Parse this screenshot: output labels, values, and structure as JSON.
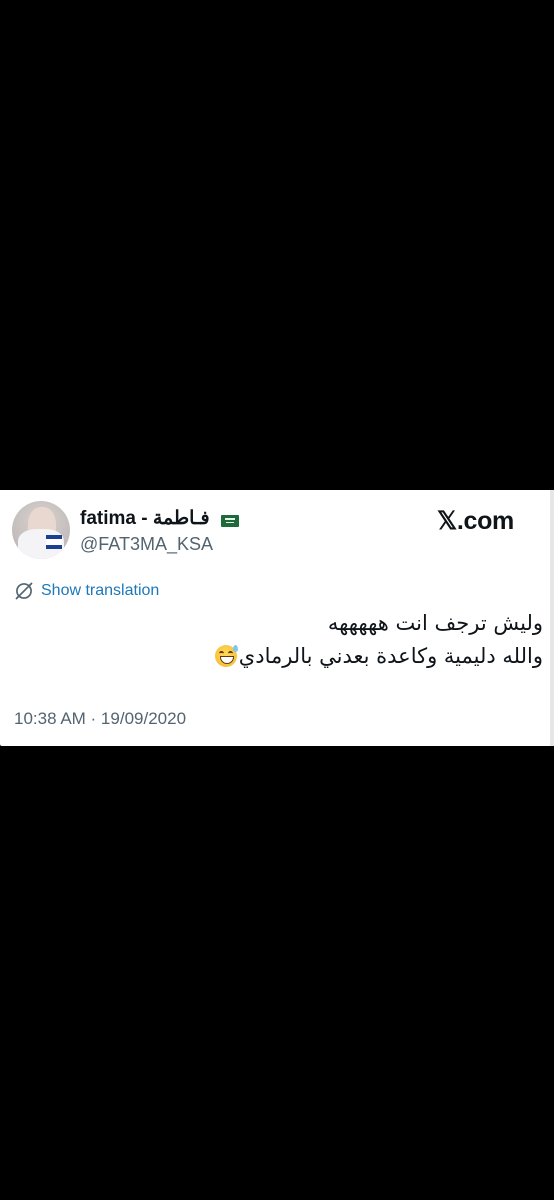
{
  "tweet_card": {
    "author": {
      "display_name": "fatima - فـاطمة",
      "handle": "@FAT3MA_KSA",
      "flag_icon": "saudi-flag-emoji"
    },
    "brand": "𝕏.com",
    "translate": {
      "icon": "translate-icon",
      "label": "Show translation"
    },
    "text_lines": [
      "وليش ترجف انت هههههه",
      "والله دليمية وكاعدة بعدني بالرمادي"
    ],
    "emoji": "grinning-face-with-sweat",
    "timestamp": "10:38 AM · 19/09/2020"
  },
  "colors": {
    "background": "#000000",
    "card": "#ffffff",
    "text_primary": "#0f1419",
    "text_secondary": "#536471",
    "link": "#1d78ba"
  }
}
